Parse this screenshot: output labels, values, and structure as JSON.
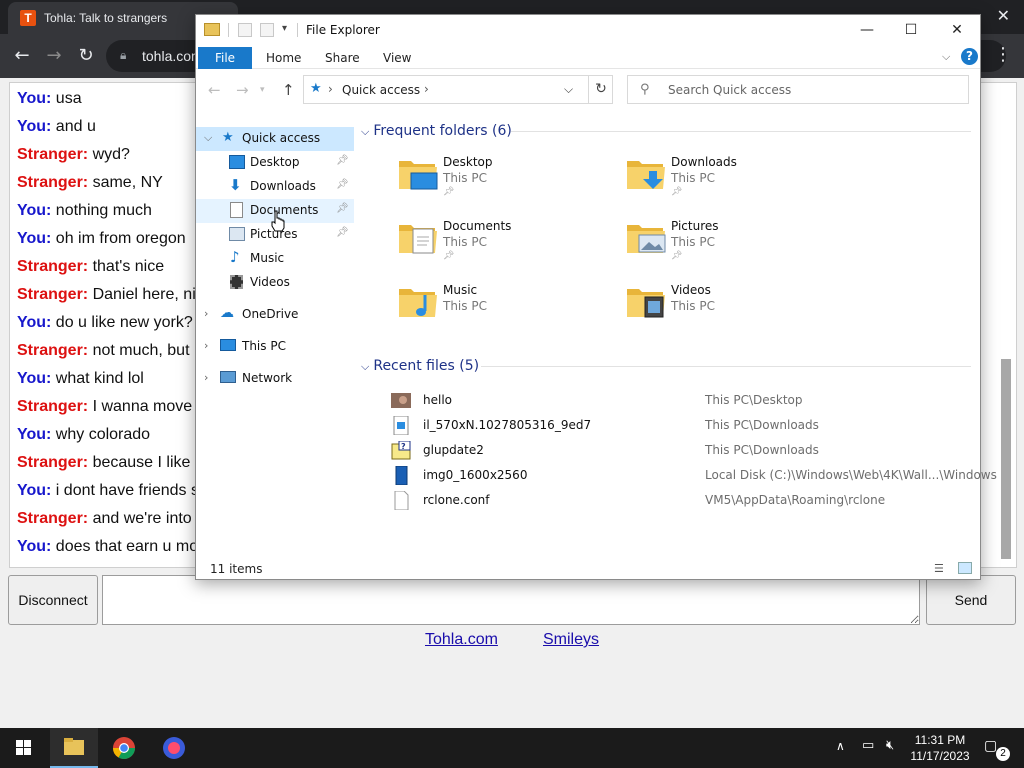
{
  "browser": {
    "tab_title": "Tohla: Talk to strangers",
    "url": "tohla.com"
  },
  "chat": {
    "messages": [
      {
        "who": "You:",
        "text": " usa"
      },
      {
        "who": "You:",
        "text": " and u"
      },
      {
        "who": "Stranger:",
        "text": " wyd?"
      },
      {
        "who": "Stranger:",
        "text": " same, NY"
      },
      {
        "who": "You:",
        "text": " nothing much"
      },
      {
        "who": "You:",
        "text": " oh im from oregon"
      },
      {
        "who": "Stranger:",
        "text": " that's nice"
      },
      {
        "who": "Stranger:",
        "text": " Daniel here, ni"
      },
      {
        "who": "You:",
        "text": " do u like new york?"
      },
      {
        "who": "Stranger:",
        "text": " not much, but I"
      },
      {
        "who": "You:",
        "text": " what kind lol"
      },
      {
        "who": "Stranger:",
        "text": " I wanna move"
      },
      {
        "who": "You:",
        "text": " why colorado"
      },
      {
        "who": "Stranger:",
        "text": " because I like"
      },
      {
        "who": "You:",
        "text": " i dont have friends s"
      },
      {
        "who": "Stranger:",
        "text": " and we're into"
      },
      {
        "who": "You:",
        "text": " does that earn u mo"
      }
    ],
    "disconnect_label": "Disconnect",
    "send_label": "Send",
    "message_value": "",
    "footer_links": [
      "Tohla.com",
      "Smileys"
    ]
  },
  "explorer": {
    "title": "File Explorer",
    "ribbon_tabs": [
      "File",
      "Home",
      "Share",
      "View"
    ],
    "help_label": "?",
    "address": {
      "location": "Quick access"
    },
    "search_placeholder": "Search Quick access",
    "nav_pane": {
      "quick_access": "Quick access",
      "pinned": [
        "Desktop",
        "Downloads",
        "Documents",
        "Pictures"
      ],
      "unpinned": [
        "Music",
        "Videos"
      ],
      "roots": [
        "OneDrive",
        "This PC",
        "Network"
      ]
    },
    "frequent_header": "Frequent folders (6)",
    "frequent_folders": [
      {
        "name": "Desktop",
        "location": "This PC",
        "pinned": true,
        "icon": "desktop-folder-icon"
      },
      {
        "name": "Downloads",
        "location": "This PC",
        "pinned": true,
        "icon": "downloads-folder-icon"
      },
      {
        "name": "Documents",
        "location": "This PC",
        "pinned": true,
        "icon": "documents-folder-icon"
      },
      {
        "name": "Pictures",
        "location": "This PC",
        "pinned": true,
        "icon": "pictures-folder-icon"
      },
      {
        "name": "Music",
        "location": "This PC",
        "pinned": false,
        "icon": "music-folder-icon"
      },
      {
        "name": "Videos",
        "location": "This PC",
        "pinned": false,
        "icon": "videos-folder-icon"
      }
    ],
    "recent_header": "Recent files (5)",
    "recent_files": [
      {
        "name": "hello",
        "path": "This PC\\Desktop",
        "icon": "image-thumb-icon"
      },
      {
        "name": "il_570xN.1027805316_9ed7",
        "path": "This PC\\Downloads",
        "icon": "image-file-icon"
      },
      {
        "name": "glupdate2",
        "path": "This PC\\Downloads",
        "icon": "help-file-icon"
      },
      {
        "name": "img0_1600x2560",
        "path": "Local Disk (C:)\\Windows\\Web\\4K\\Wall...\\Windows",
        "icon": "wallpaper-file-icon"
      },
      {
        "name": "rclone.conf",
        "path": "VM5\\AppData\\Roaming\\rclone",
        "icon": "text-file-icon"
      }
    ],
    "status": "11 items"
  },
  "taskbar": {
    "time": "11:31 PM",
    "date": "11/17/2023",
    "notifications": "2"
  },
  "colors": {
    "you": "#1717cc",
    "stranger": "#dd1111",
    "accent": "#1979ca",
    "section_header": "#1e3287"
  }
}
